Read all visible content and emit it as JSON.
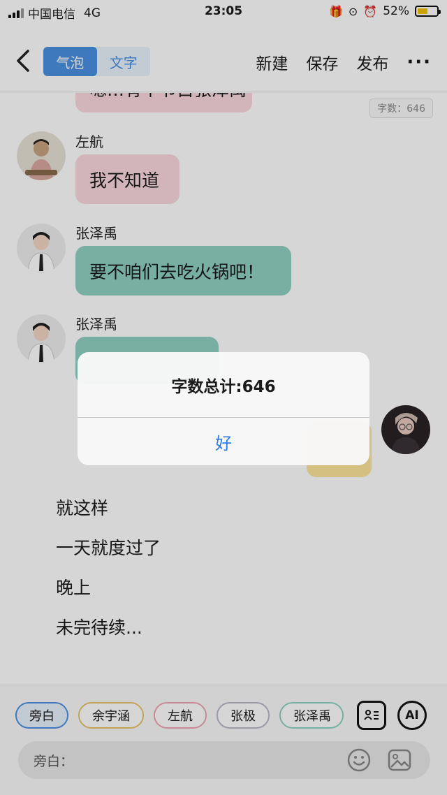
{
  "status": {
    "carrier": "中国电信",
    "network": "4G",
    "time": "23:05",
    "battery": "52%",
    "battery_level": 0.52
  },
  "nav": {
    "tab_bubble": "气泡",
    "tab_text": "文字",
    "new": "新建",
    "save": "保存",
    "publish": "发布",
    "more": "···"
  },
  "chat": {
    "word_count_badge": "字数：646",
    "messages": [
      {
        "speaker": "",
        "text": "嗯…有个节目张泽禹"
      },
      {
        "speaker": "左航",
        "text": "我不知道"
      },
      {
        "speaker": "张泽禹",
        "text": "要不咱们去吃火锅吧！"
      },
      {
        "speaker": "张泽禹",
        "text": ""
      },
      {
        "speaker": "",
        "text": ""
      }
    ],
    "narration": [
      "就这样",
      "一天就度过了",
      "晚上",
      "未完待续..."
    ]
  },
  "characters": [
    "旁白",
    "余宇涵",
    "左航",
    "张极",
    "张泽禹"
  ],
  "toolbar": {
    "ai_label": "AI"
  },
  "input": {
    "placeholder": "旁白："
  },
  "dialog": {
    "message": "字数总计:646",
    "ok": "好"
  },
  "colors": {
    "accent": "#4a90e2",
    "bubble_pink": "#fbd8df",
    "bubble_teal": "#8fd1c2",
    "bubble_yellow": "#fde59a",
    "dialog_button": "#2f7ae5"
  }
}
